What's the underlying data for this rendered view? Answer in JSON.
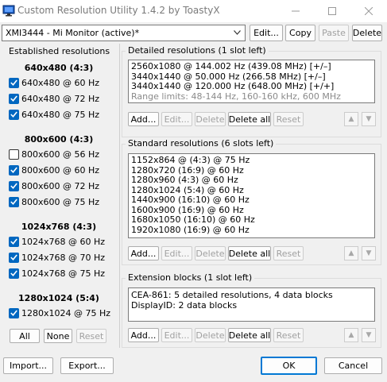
{
  "window": {
    "title": "Custom Resolution Utility 1.4.2 by ToastyX"
  },
  "monitor": {
    "selected": "XMI3444 - Mi Monitor (active)*",
    "buttons": {
      "edit": "Edit...",
      "copy": "Copy",
      "paste": "Paste",
      "delete": "Delete"
    }
  },
  "established": {
    "title": "Established resolutions",
    "groups": [
      {
        "heading": "640x480 (4:3)",
        "items": [
          {
            "label": "640x480 @ 60 Hz",
            "checked": true
          },
          {
            "label": "640x480 @ 72 Hz",
            "checked": true
          },
          {
            "label": "640x480 @ 75 Hz",
            "checked": true
          }
        ]
      },
      {
        "heading": "800x600 (4:3)",
        "items": [
          {
            "label": "800x600 @ 56 Hz",
            "checked": false
          },
          {
            "label": "800x600 @ 60 Hz",
            "checked": true
          },
          {
            "label": "800x600 @ 72 Hz",
            "checked": true
          },
          {
            "label": "800x600 @ 75 Hz",
            "checked": true
          }
        ]
      },
      {
        "heading": "1024x768 (4:3)",
        "items": [
          {
            "label": "1024x768 @ 60 Hz",
            "checked": true
          },
          {
            "label": "1024x768 @ 70 Hz",
            "checked": true
          },
          {
            "label": "1024x768 @ 75 Hz",
            "checked": true
          }
        ]
      },
      {
        "heading": "1280x1024 (5:4)",
        "items": [
          {
            "label": "1280x1024 @ 75 Hz",
            "checked": true
          }
        ]
      }
    ],
    "buttons": {
      "all": "All",
      "none": "None",
      "reset": "Reset"
    }
  },
  "detailed": {
    "title": "Detailed resolutions (1 slot left)",
    "rows": [
      "2560x1080 @ 144.002 Hz (439.08 MHz) [+/–]",
      "3440x1440 @ 50.000 Hz (266.58 MHz) [+/–]",
      "3440x1440 @ 120.000 Hz (648.00 MHz) [+/+]"
    ],
    "range": "Range limits: 48-144 Hz, 160-160 kHz, 600 MHz"
  },
  "standard": {
    "title": "Standard resolutions (6 slots left)",
    "rows": [
      "1152x864 @ (4:3) @ 75 Hz",
      "1280x720 (16:9) @ 60 Hz",
      "1280x960 (4:3) @ 60 Hz",
      "1280x1024 (5:4) @ 60 Hz",
      "1440x900 (16:10) @ 60 Hz",
      "1600x900 (16:9) @ 60 Hz",
      "1680x1050 (16:10) @ 60 Hz",
      "1920x1080 (16:9) @ 60 Hz"
    ]
  },
  "extension": {
    "title": "Extension blocks (1 slot left)",
    "rows": [
      "CEA-861: 5 detailed resolutions, 4 data blocks",
      "DisplayID: 2 data blocks"
    ]
  },
  "section_buttons": {
    "add": "Add...",
    "edit": "Edit...",
    "delete": "Delete",
    "delete_all": "Delete all",
    "reset": "Reset"
  },
  "footer": {
    "import": "Import...",
    "export": "Export...",
    "ok": "OK",
    "cancel": "Cancel"
  },
  "colors": {
    "accent": "#0067c0",
    "default_border": "#0078d4",
    "disabled_text": "#a0a0a0"
  }
}
